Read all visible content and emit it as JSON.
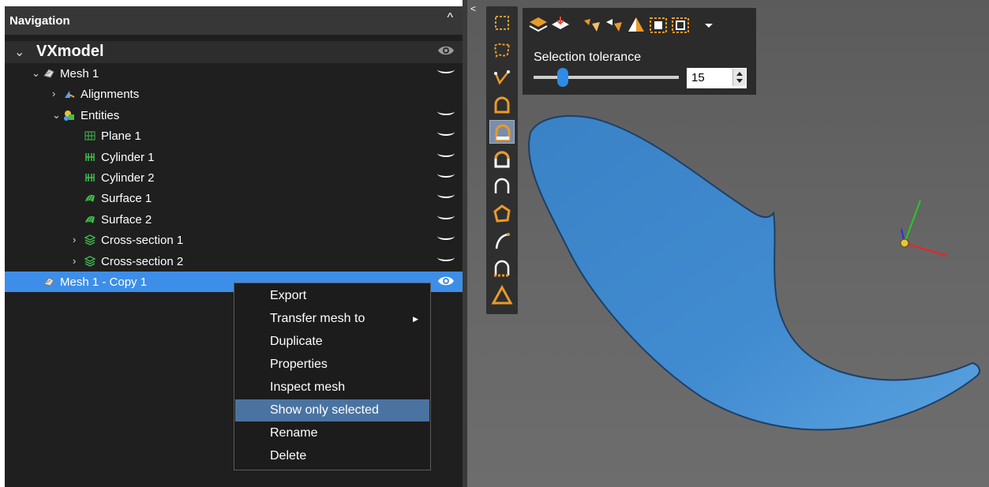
{
  "navigation": {
    "title": "Navigation",
    "collapse_glyph": "^",
    "tree": [
      {
        "label": "VXmodel",
        "level": 0,
        "expander": "⌄",
        "icon": "",
        "visibility": "eye"
      },
      {
        "label": "Mesh 1",
        "level": 1,
        "expander": "⌄",
        "icon": "mesh-icon",
        "visibility": "hidden"
      },
      {
        "label": "Alignments",
        "level": 2,
        "expander": "›",
        "icon": "alignment-icon",
        "visibility": "none"
      },
      {
        "label": "Entities",
        "level": 2,
        "expander": "⌄",
        "icon": "entities-icon",
        "visibility": "hidden"
      },
      {
        "label": "Plane 1",
        "level": 3,
        "expander": "",
        "icon": "plane-icon",
        "visibility": "hidden"
      },
      {
        "label": "Cylinder 1",
        "level": 3,
        "expander": "",
        "icon": "cylinder-icon",
        "visibility": "hidden"
      },
      {
        "label": "Cylinder 2",
        "level": 3,
        "expander": "",
        "icon": "cylinder-icon",
        "visibility": "hidden"
      },
      {
        "label": "Surface 1",
        "level": 3,
        "expander": "",
        "icon": "surface-icon",
        "visibility": "hidden"
      },
      {
        "label": "Surface 2",
        "level": 3,
        "expander": "",
        "icon": "surface-icon",
        "visibility": "hidden"
      },
      {
        "label": "Cross-section 1",
        "level": 3,
        "expander": "›",
        "icon": "cross-section-icon",
        "visibility": "hidden"
      },
      {
        "label": "Cross-section 2",
        "level": 3,
        "expander": "›",
        "icon": "cross-section-icon",
        "visibility": "hidden"
      },
      {
        "label": "Mesh 1 - Copy 1",
        "level": 1,
        "expander": "",
        "icon": "mesh-icon",
        "visibility": "eye",
        "selected": true
      }
    ]
  },
  "context_menu": {
    "items": [
      {
        "label": "Export"
      },
      {
        "label": "Transfer mesh to",
        "submenu": true
      },
      {
        "label": "Duplicate"
      },
      {
        "label": "Properties"
      },
      {
        "label": "Inspect mesh"
      },
      {
        "label": "Show only selected",
        "highlighted": true
      },
      {
        "label": "Rename"
      },
      {
        "label": "Delete"
      }
    ],
    "submenu_glyph": "▶"
  },
  "viewport": {
    "collapse_glyph": "<",
    "side_tools": [
      "rectangle-select-icon",
      "freeform-select-icon",
      "polyline-select-icon",
      "surface-select-icon",
      "surface-select-active-icon",
      "surface-select-alt-icon",
      "surface-select-outline-icon",
      "polygon-select-icon",
      "curve-select-icon",
      "boundary-select-icon",
      "triangle-select-icon"
    ],
    "top_tools": [
      "select-through-icon",
      "select-visible-icon",
      "grow-selection-icon",
      "shrink-selection-icon",
      "invert-selection-icon",
      "select-all-icon",
      "deselect-all-icon",
      "dropdown-icon"
    ],
    "selection_tolerance": {
      "label": "Selection tolerance",
      "value": "15",
      "slider_fraction": 0.2
    }
  },
  "colors": {
    "panel_bg": "#1f1f1f",
    "header_bg": "#373737",
    "selection": "#3d8ee8",
    "menu_highlight": "#4a73a1",
    "mesh": "#3f86c9",
    "icon_orange": "#e89a2b"
  }
}
